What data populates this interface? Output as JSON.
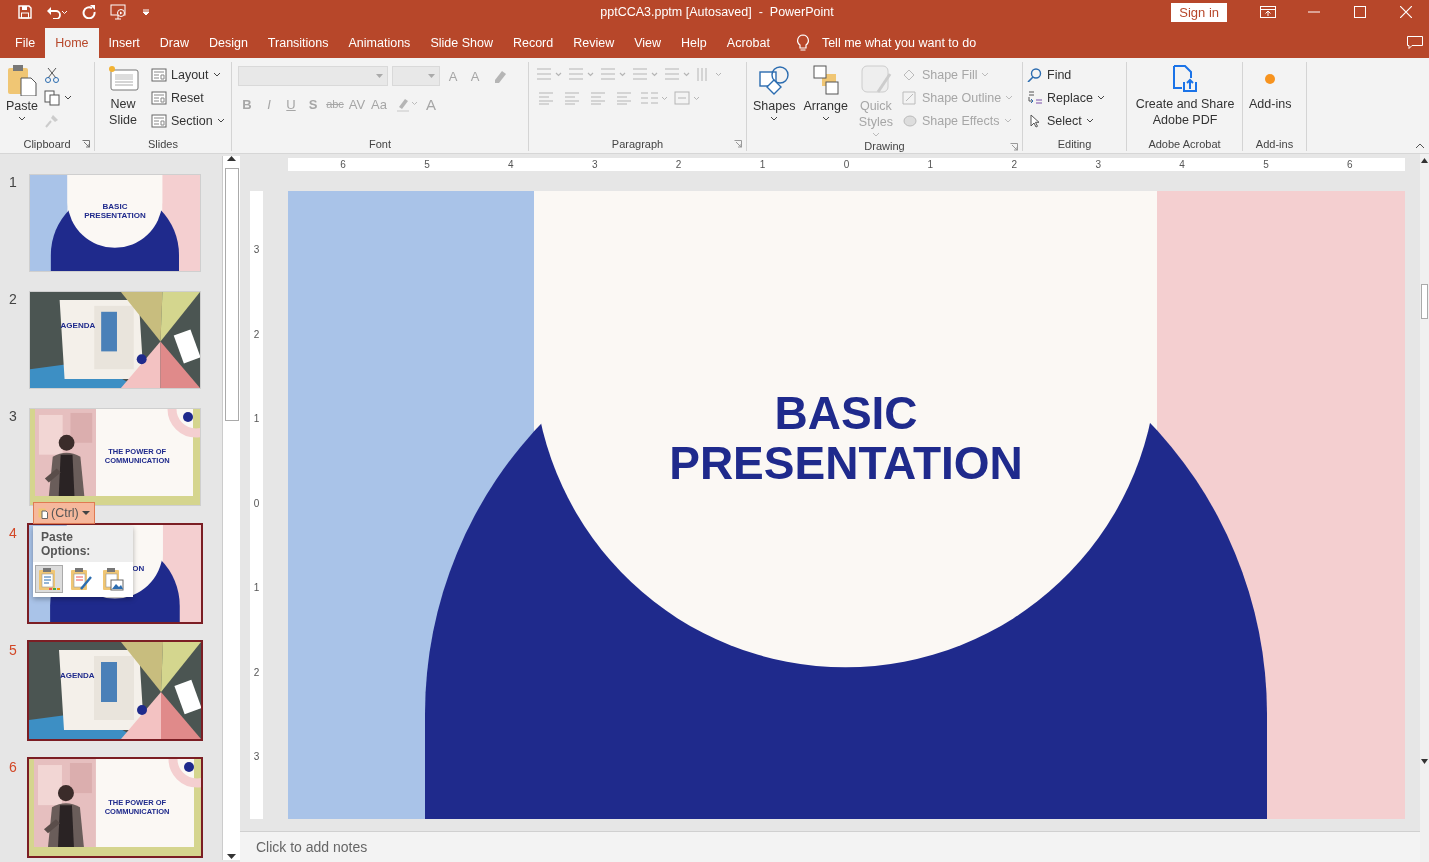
{
  "title_bar": {
    "title": "pptCCA3.pptm [Autosaved]  -  PowerPoint",
    "sign_in": "Sign in"
  },
  "tabs": [
    {
      "label": "File",
      "selected": false
    },
    {
      "label": "Home",
      "selected": true
    },
    {
      "label": "Insert",
      "selected": false
    },
    {
      "label": "Draw",
      "selected": false
    },
    {
      "label": "Design",
      "selected": false
    },
    {
      "label": "Transitions",
      "selected": false
    },
    {
      "label": "Animations",
      "selected": false
    },
    {
      "label": "Slide Show",
      "selected": false
    },
    {
      "label": "Record",
      "selected": false
    },
    {
      "label": "Review",
      "selected": false
    },
    {
      "label": "View",
      "selected": false
    },
    {
      "label": "Help",
      "selected": false
    },
    {
      "label": "Acrobat",
      "selected": false
    }
  ],
  "tell_me": {
    "label": "Tell me what you want to do"
  },
  "ribbon": {
    "clipboard": {
      "label": "Clipboard",
      "paste": "Paste"
    },
    "slides": {
      "label": "Slides",
      "new_slide": "New Slide",
      "items": [
        {
          "label": "Layout",
          "dropdown": true
        },
        {
          "label": "Reset",
          "dropdown": false
        },
        {
          "label": "Section",
          "dropdown": true
        }
      ]
    },
    "font": {
      "label": "Font",
      "disabled": true,
      "size_buttons": [
        "A",
        "A"
      ],
      "format_buttons": [
        "B",
        "I",
        "U",
        "S",
        "abc",
        "AV",
        "Aa"
      ],
      "color_button": "A"
    },
    "paragraph": {
      "label": "Paragraph",
      "disabled": true
    },
    "drawing": {
      "label": "Drawing",
      "buttons": [
        {
          "label": "Shapes",
          "disabled": false
        },
        {
          "label": "Arrange",
          "disabled": false
        },
        {
          "label": "Quick Styles",
          "disabled": true
        }
      ],
      "items": [
        {
          "label": "Shape Fill",
          "disabled": true
        },
        {
          "label": "Shape Outline",
          "disabled": true
        },
        {
          "label": "Shape Effects",
          "disabled": true
        }
      ]
    },
    "editing": {
      "label": "Editing",
      "items": [
        {
          "label": "Find",
          "dropdown": false
        },
        {
          "label": "Replace",
          "dropdown": true
        },
        {
          "label": "Select",
          "dropdown": true
        }
      ]
    },
    "acrobat": {
      "label": "Adobe Acrobat",
      "button": "Create and Share Adobe PDF"
    },
    "addins": {
      "label": "Add-ins",
      "button": "Add-ins"
    }
  },
  "thumbnails": [
    {
      "number": "1",
      "kind": "title",
      "selected": false,
      "texts": [
        "BASIC",
        "PRESENTATION"
      ]
    },
    {
      "number": "2",
      "kind": "agenda",
      "selected": false,
      "texts": [
        "AGENDA"
      ]
    },
    {
      "number": "3",
      "kind": "quote",
      "selected": false,
      "texts": [
        "THE POWER OF",
        "COMMUNICATION"
      ]
    },
    {
      "number": "4",
      "kind": "title_cut",
      "selected": true,
      "texts": [
        "ON"
      ]
    },
    {
      "number": "5",
      "kind": "agenda",
      "selected": true,
      "texts": [
        "AGENDA"
      ]
    },
    {
      "number": "6",
      "kind": "quote",
      "selected": true,
      "texts": [
        "THE POWER OF",
        "COMMUNICATION"
      ]
    }
  ],
  "paste_options": {
    "ctrl": "(Ctrl)",
    "title": "Paste Options:",
    "options": [
      {
        "kind": "keep-source",
        "selected": true
      },
      {
        "kind": "destination",
        "selected": false
      },
      {
        "kind": "picture",
        "selected": false
      }
    ]
  },
  "rulers": {
    "horizontal": [
      "6",
      "5",
      "4",
      "3",
      "2",
      "1",
      "0",
      "1",
      "2",
      "3",
      "4",
      "5",
      "6"
    ],
    "vertical": [
      "3",
      "2",
      "1",
      "0",
      "1",
      "2",
      "3"
    ]
  },
  "slide": {
    "title": [
      "BASIC",
      "PRESENTATION"
    ]
  },
  "notes": {
    "placeholder": "Click to add notes"
  }
}
